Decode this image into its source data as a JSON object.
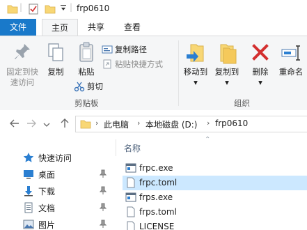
{
  "window": {
    "title": "frp0610"
  },
  "tabs": {
    "file": "文件",
    "home": "主页",
    "share": "共享",
    "view": "查看"
  },
  "ribbon": {
    "pin_label_1": "固定到快",
    "pin_label_2": "速访问",
    "copy": "复制",
    "paste": "粘贴",
    "copy_path": "复制路径",
    "paste_shortcut": "粘贴快捷方式",
    "cut": "剪切",
    "clipboard_group": "剪贴板",
    "move_to": "移动到",
    "copy_to": "复制到",
    "delete": "删除",
    "rename": "重命名",
    "organize_group": "组织"
  },
  "address": {
    "crumbs": [
      "此电脑",
      "本地磁盘 (D:)",
      "frp0610"
    ]
  },
  "nav": {
    "items": [
      {
        "label": "快速访问",
        "icon": "star-icon"
      },
      {
        "label": "桌面",
        "icon": "desktop-icon"
      },
      {
        "label": "下载",
        "icon": "download-icon"
      },
      {
        "label": "文档",
        "icon": "document-icon"
      },
      {
        "label": "图片",
        "icon": "picture-icon"
      }
    ]
  },
  "content": {
    "column_name": "名称",
    "files": [
      {
        "name": "frpc.exe",
        "icon": "exe-icon"
      },
      {
        "name": "frpc.toml",
        "icon": "file-icon",
        "selected": true
      },
      {
        "name": "frps.exe",
        "icon": "exe-icon"
      },
      {
        "name": "frps.toml",
        "icon": "file-icon"
      },
      {
        "name": "LICENSE",
        "icon": "file-icon"
      }
    ]
  },
  "colors": {
    "accent": "#1979ca",
    "ribbon_bg": "#f5f6f7",
    "selected_row": "#cce8ff",
    "delete_red": "#d32f2f",
    "folder_yellow": "#f8d775"
  }
}
